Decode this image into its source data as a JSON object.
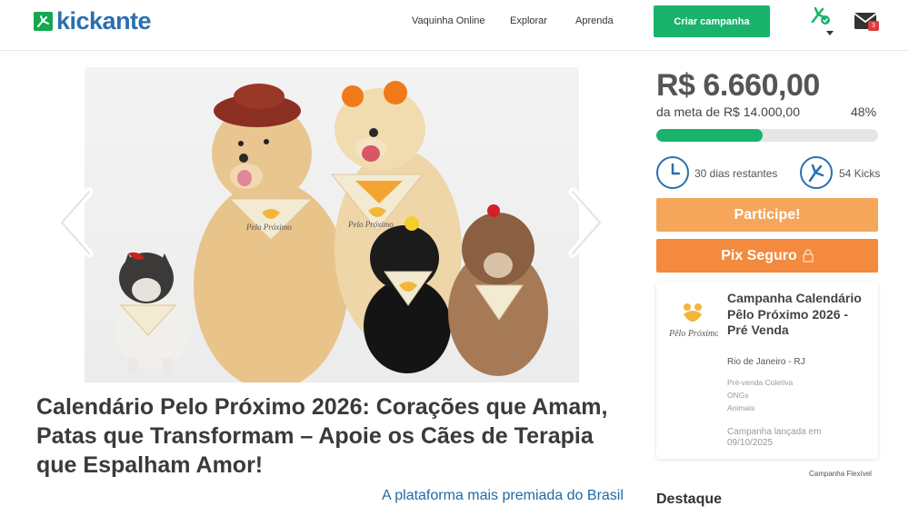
{
  "header": {
    "brand": "kickante",
    "nav": [
      "Vaquinha Online",
      "Explorar",
      "Aprenda"
    ],
    "cta": "Criar campanha",
    "mail_badge": "3"
  },
  "hero": {
    "bandana_text": "Pelo Próximo"
  },
  "campaign": {
    "title": "Calendário Pelo Próximo 2026: Corações que Amam, Patas que Transformam – Apoie os Cães de Terapia que Espalham Amor!",
    "tagline": "A plataforma mais premiada do Brasil"
  },
  "funding": {
    "amount": "R$ 6.660,00",
    "goal": "da meta de R$ 14.000,00",
    "percent": "48%",
    "progress": 0.48,
    "days": "30 dias restantes",
    "kicks": "54 Kicks",
    "participe": "Participe!",
    "pix": "Pix Seguro"
  },
  "card": {
    "logo_text": "Pêlo Próximo",
    "title": "Campanha Calendário Pêlo Próximo 2026 - Pré Venda",
    "location": "Rio de Janeiro - RJ",
    "categories": [
      "Pré-venda Coletiva",
      "ONGs",
      "Animais"
    ],
    "launch": "Campanha lançada em 09/10/2025"
  },
  "flex_note": "Campanha Flexível",
  "destaque": "Destaque",
  "colors": {
    "green": "#19b36b",
    "blue": "#2a6fb0",
    "orange": "#f48a3d",
    "light_orange": "#f5a65b"
  }
}
